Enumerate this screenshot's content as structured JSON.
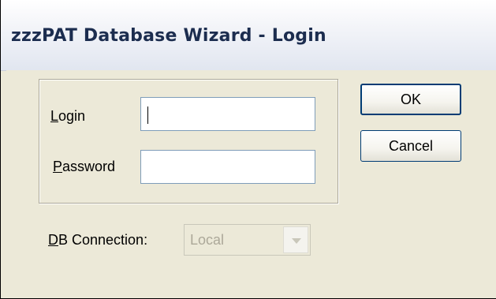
{
  "window": {
    "title": "zzzPAT Database Wizard - Login"
  },
  "credentials": {
    "login_label_accel": "L",
    "login_label_rest": "ogin",
    "login_value": "",
    "password_label_accel": "P",
    "password_label_rest": "assword",
    "password_value": ""
  },
  "connection": {
    "label_accel": "D",
    "label_rest": "B Connection:",
    "selected": "Local"
  },
  "buttons": {
    "ok": "OK",
    "cancel": "Cancel"
  },
  "icons": {
    "combo_arrow": "chevron-down-icon"
  }
}
